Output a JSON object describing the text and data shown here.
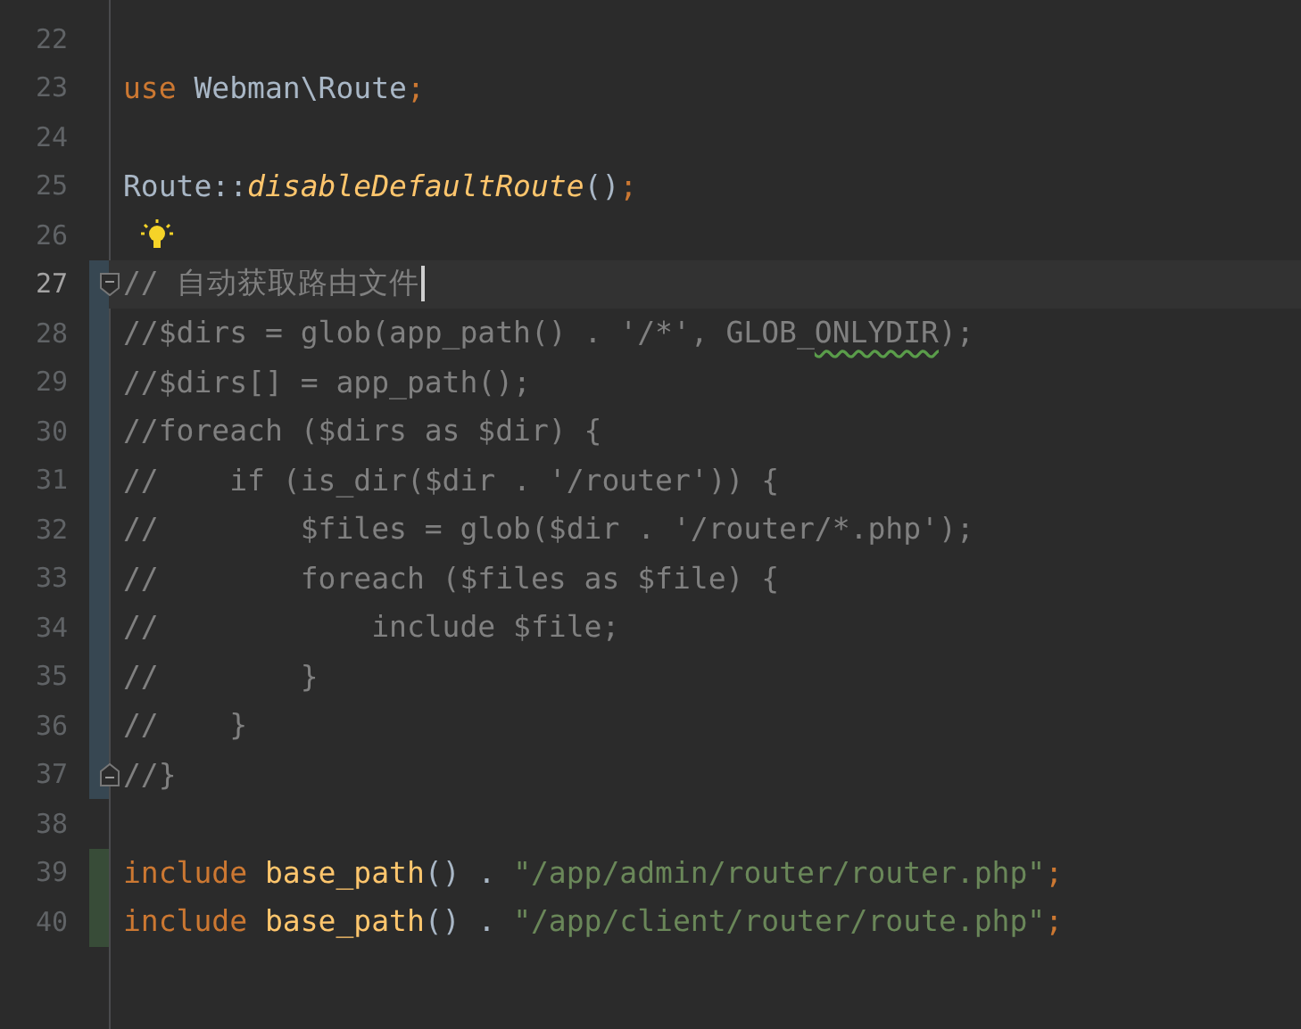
{
  "editor": {
    "lines": [
      {
        "number": "22",
        "current": false
      },
      {
        "number": "23",
        "current": false,
        "tokens": [
          {
            "kind": "keyword",
            "text": "use "
          },
          {
            "kind": "plain",
            "text": "Webman\\Route"
          },
          {
            "kind": "keyword",
            "text": ";"
          }
        ]
      },
      {
        "number": "24",
        "current": false
      },
      {
        "number": "25",
        "current": false,
        "tokens": [
          {
            "kind": "plain",
            "text": "Route::"
          },
          {
            "kind": "method",
            "text": "disableDefaultRoute"
          },
          {
            "kind": "plain",
            "text": "()"
          },
          {
            "kind": "keyword",
            "text": ";"
          }
        ]
      },
      {
        "number": "26",
        "current": false,
        "bulb": true
      },
      {
        "number": "27",
        "current": true,
        "modified": true,
        "fold_start": true,
        "caret": true,
        "tokens": [
          {
            "kind": "comment",
            "text": "// 自动获取路由文件"
          }
        ]
      },
      {
        "number": "28",
        "current": false,
        "modified": true,
        "tokens": [
          {
            "kind": "comment",
            "text": "//$dirs = glob(app_path() . '/*', GLOB_"
          },
          {
            "kind": "warning",
            "text": "ONLYDIR"
          },
          {
            "kind": "comment",
            "text": ");"
          }
        ]
      },
      {
        "number": "29",
        "current": false,
        "modified": true,
        "tokens": [
          {
            "kind": "comment",
            "text": "//$dirs[] = app_path();"
          }
        ]
      },
      {
        "number": "30",
        "current": false,
        "modified": true,
        "tokens": [
          {
            "kind": "comment",
            "text": "//foreach ($dirs as $dir) {"
          }
        ]
      },
      {
        "number": "31",
        "current": false,
        "modified": true,
        "tokens": [
          {
            "kind": "comment",
            "text": "//    if (is_dir($dir . '/router')) {"
          }
        ]
      },
      {
        "number": "32",
        "current": false,
        "modified": true,
        "tokens": [
          {
            "kind": "comment",
            "text": "//        $files = glob($dir . '/router/*.php');"
          }
        ]
      },
      {
        "number": "33",
        "current": false,
        "modified": true,
        "tokens": [
          {
            "kind": "comment",
            "text": "//        foreach ($files as $file) {"
          }
        ]
      },
      {
        "number": "34",
        "current": false,
        "modified": true,
        "tokens": [
          {
            "kind": "comment",
            "text": "//            include $file;"
          }
        ]
      },
      {
        "number": "35",
        "current": false,
        "modified": true,
        "tokens": [
          {
            "kind": "comment",
            "text": "//        }"
          }
        ]
      },
      {
        "number": "36",
        "current": false,
        "modified": true,
        "tokens": [
          {
            "kind": "comment",
            "text": "//    }"
          }
        ]
      },
      {
        "number": "37",
        "current": false,
        "modified": true,
        "fold_end": true,
        "tokens": [
          {
            "kind": "comment",
            "text": "//}"
          }
        ]
      },
      {
        "number": "38",
        "current": false
      },
      {
        "number": "39",
        "current": false,
        "added": true,
        "tokens": [
          {
            "kind": "keyword",
            "text": "include "
          },
          {
            "kind": "function",
            "text": "base_path"
          },
          {
            "kind": "plain",
            "text": "() . "
          },
          {
            "kind": "string",
            "text": "\"/app/admin/router/router.php\""
          },
          {
            "kind": "keyword",
            "text": ";"
          }
        ]
      },
      {
        "number": "40",
        "current": false,
        "added": true,
        "tokens": [
          {
            "kind": "keyword",
            "text": "include "
          },
          {
            "kind": "function",
            "text": "base_path"
          },
          {
            "kind": "plain",
            "text": "() . "
          },
          {
            "kind": "string",
            "text": "\"/app/client/router/route.php\""
          },
          {
            "kind": "keyword",
            "text": ";"
          }
        ]
      }
    ]
  }
}
